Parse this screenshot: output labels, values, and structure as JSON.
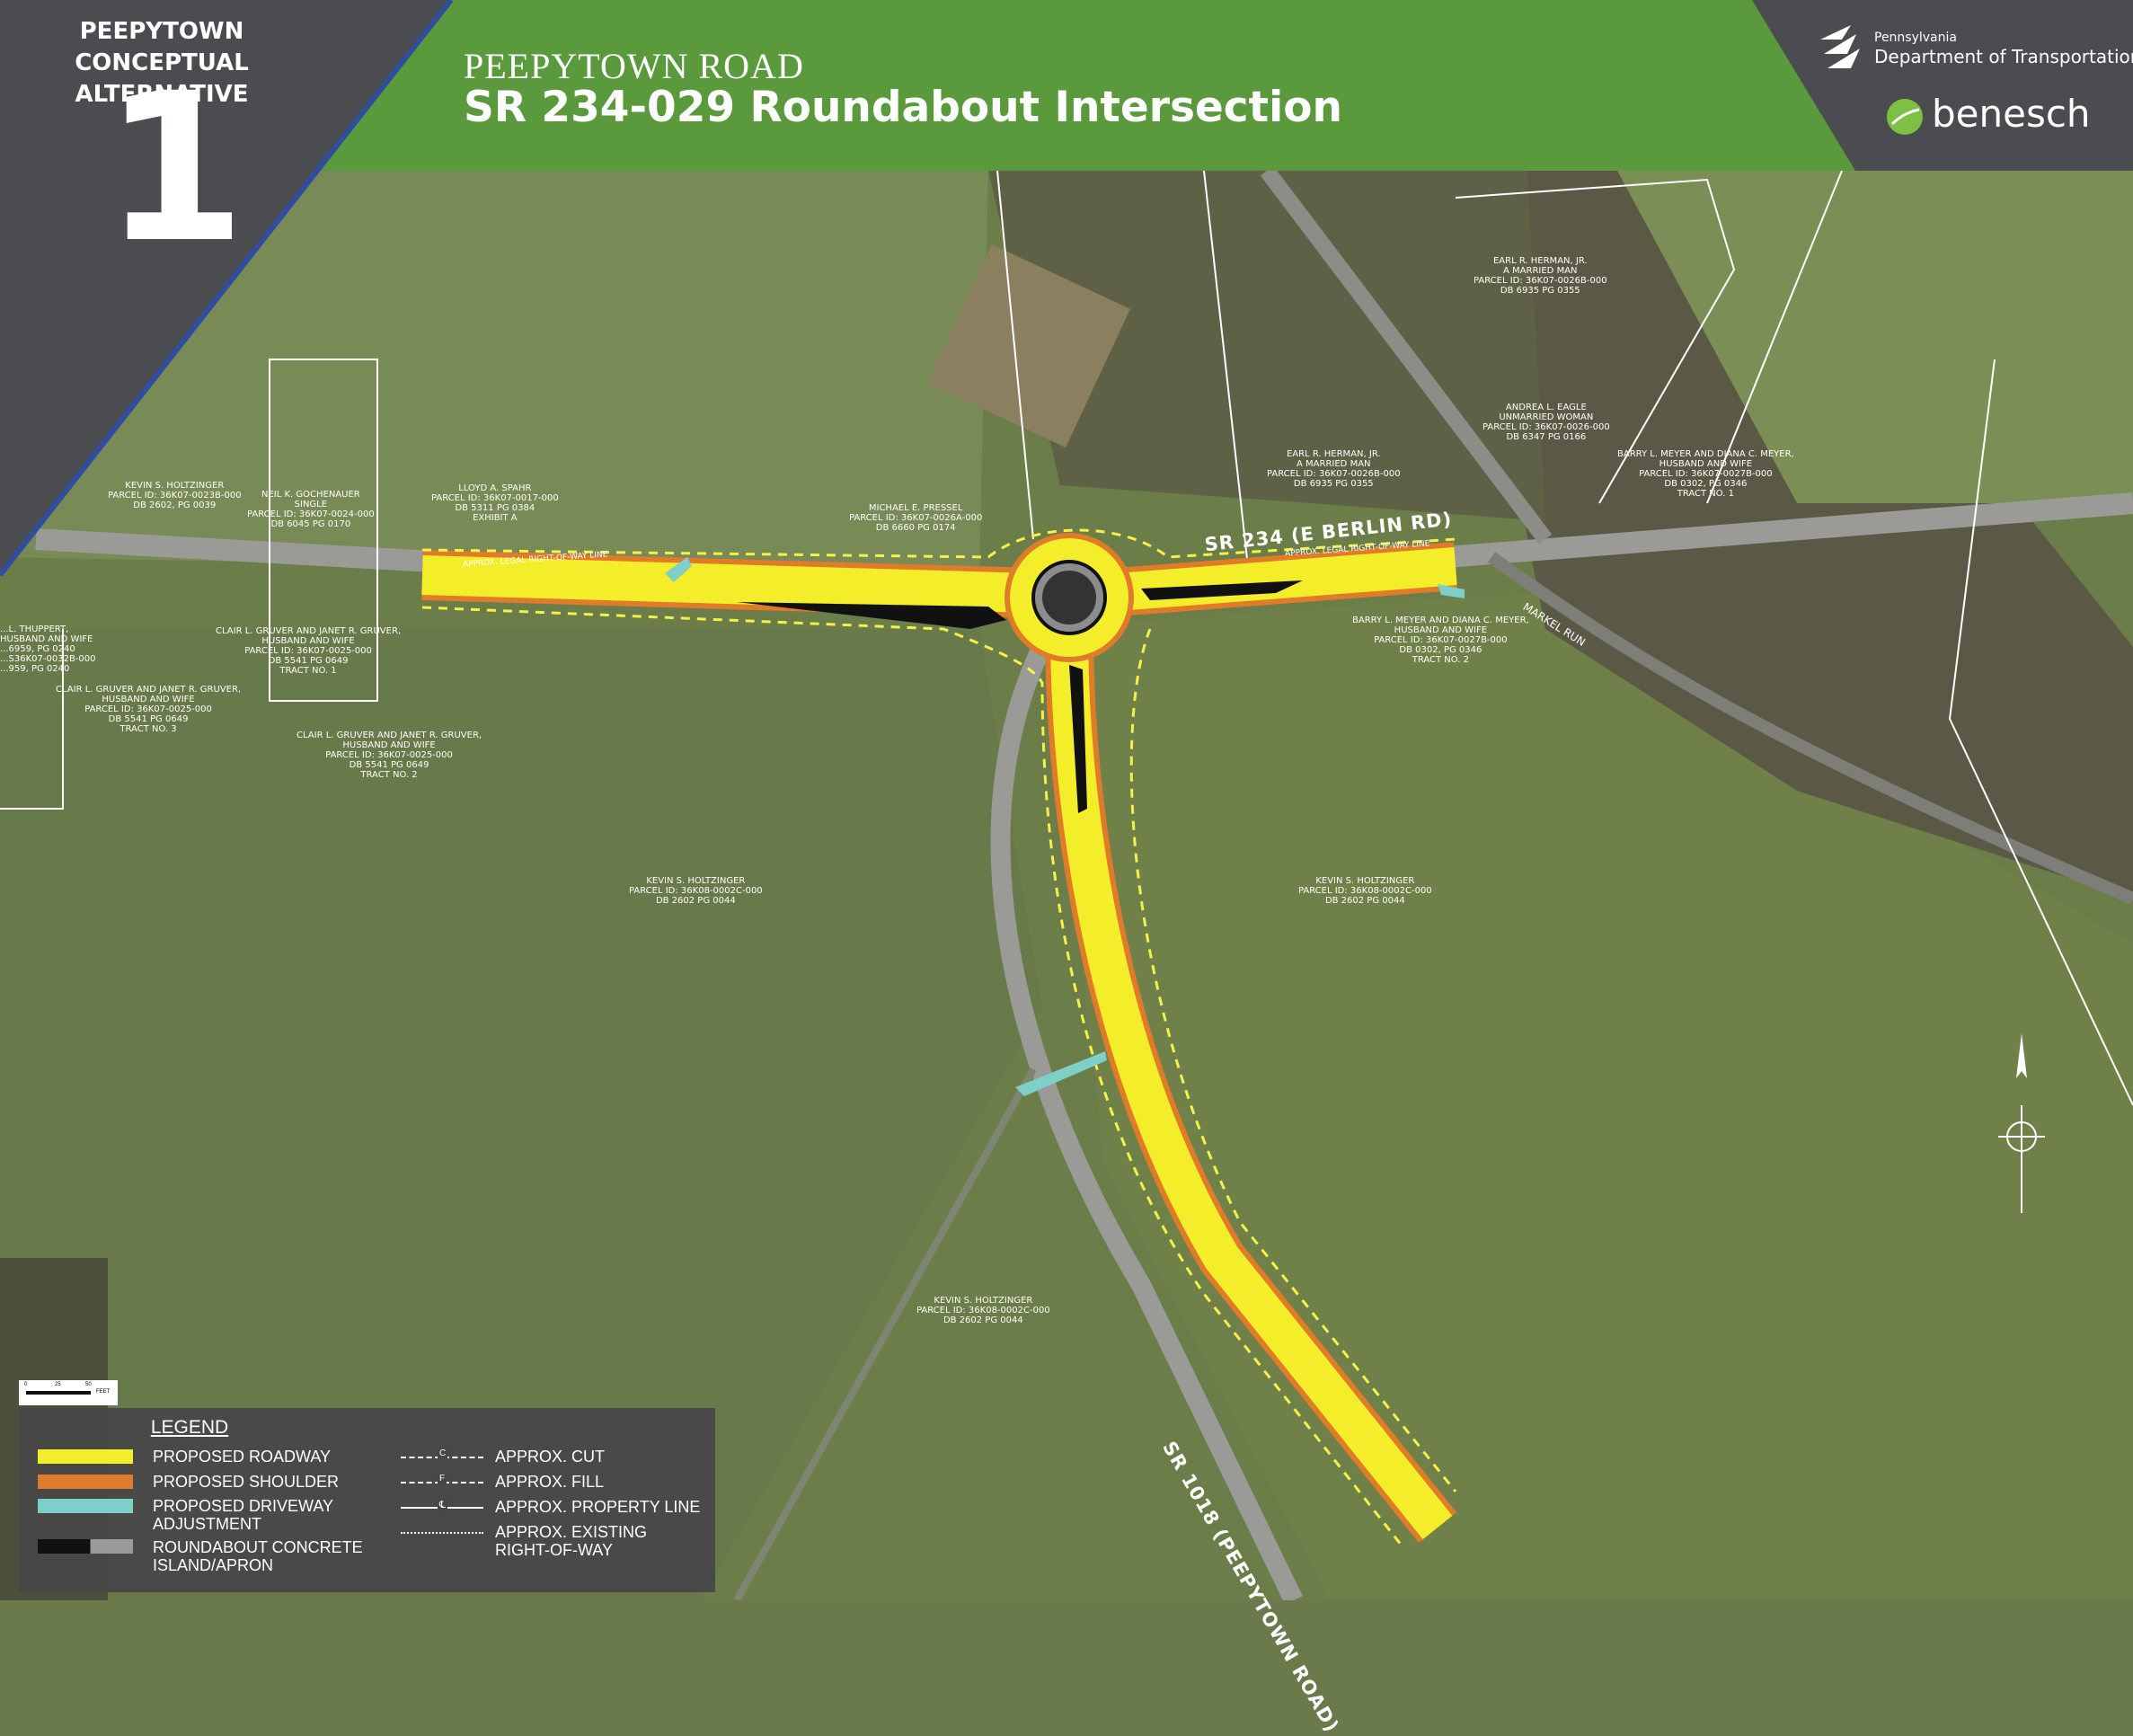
{
  "header": {
    "alt_title_line1": "PEEPYTOWN",
    "alt_title_line2": "CONCEPTUAL ALTERNATIVE",
    "alt_number": "1",
    "project_subtitle": "PEEPYTOWN ROAD",
    "project_title": "SR 234-029 Roundabout Intersection",
    "penndot_small": "Pennsylvania",
    "penndot_big": "Department of Transportation",
    "benesch": "benesch"
  },
  "roads": {
    "sr234": "SR 234 (E BERLIN RD)",
    "sr1018": "SR 1018 (PEEPYTOWN ROAD)",
    "markel": "MARKEL RUN"
  },
  "parcels": [
    {
      "id": "p1",
      "lines": [
        "KEVIN S. HOLTZINGER",
        "PARCEL ID: 36K07-0023B-000",
        "DB 2602, PG 0039"
      ]
    },
    {
      "id": "p2",
      "lines": [
        "NEIL K. GOCHENAUER",
        "SINGLE",
        "PARCEL ID: 36K07-0024-000",
        "DB 6045 PG 0170"
      ]
    },
    {
      "id": "p3",
      "lines": [
        "LLOYD A. SPAHR",
        "PARCEL ID: 36K07-0017-000",
        "DB 5311 PG 0384",
        "EXHIBIT A"
      ]
    },
    {
      "id": "p4",
      "lines": [
        "MICHAEL E. PRESSEL",
        "PARCEL ID: 36K07-0026A-000",
        "DB 6660 PG 0174"
      ]
    },
    {
      "id": "p5",
      "lines": [
        "EARL R. HERMAN, JR.",
        "A MARRIED MAN",
        "PARCEL ID: 36K07-0026B-000",
        "DB 6935 PG 0355"
      ]
    },
    {
      "id": "p6",
      "lines": [
        "EARL R. HERMAN, JR.",
        "A MARRIED MAN",
        "PARCEL ID: 36K07-0026B-000",
        "DB 6935 PG 0355"
      ]
    },
    {
      "id": "p7",
      "lines": [
        "ANDREA L. EAGLE",
        "UNMARRIED WOMAN",
        "PARCEL ID: 36K07-0026-000",
        "DB 6347 PG 0166"
      ]
    },
    {
      "id": "p8",
      "lines": [
        "BARRY L. MEYER AND DIANA C. MEYER,",
        "HUSBAND AND WIFE",
        "PARCEL ID: 36K07-0027B-000",
        "DB 0302, PG 0346",
        "TRACT NO. 1"
      ]
    },
    {
      "id": "p9",
      "lines": [
        "BARRY L. MEYER AND DIANA C. MEYER,",
        "HUSBAND AND WIFE",
        "PARCEL ID: 36K07-0027B-000",
        "DB 0302, PG 0346",
        "TRACT NO. 2"
      ]
    },
    {
      "id": "p10",
      "lines": [
        "CLAIR L. GRUVER AND JANET R. GRUVER,",
        "HUSBAND AND WIFE",
        "PARCEL ID: 36K07-0025-000",
        "DB 5541 PG 0649",
        "TRACT NO. 1"
      ]
    },
    {
      "id": "p11",
      "lines": [
        "CLAIR L. GRUVER AND JANET R. GRUVER,",
        "HUSBAND AND WIFE",
        "PARCEL ID: 36K07-0025-000",
        "DB 5541 PG 0649",
        "TRACT NO. 3"
      ]
    },
    {
      "id": "p12",
      "lines": [
        "CLAIR L. GRUVER AND JANET R. GRUVER,",
        "HUSBAND AND WIFE",
        "PARCEL ID: 36K07-0025-000",
        "DB 5541 PG 0649",
        "TRACT NO. 2"
      ]
    },
    {
      "id": "p13",
      "lines": [
        "KEVIN S. HOLTZINGER",
        "PARCEL ID: 36K08-0002C-000",
        "DB 2602 PG 0044"
      ]
    },
    {
      "id": "p14",
      "lines": [
        "KEVIN S. HOLTZINGER",
        "PARCEL ID: 36K08-0002C-000",
        "DB 2602 PG 0044"
      ]
    },
    {
      "id": "p15",
      "lines": [
        "KEVIN S. HOLTZINGER",
        "PARCEL ID: 36K08-0002C-000",
        "DB 2602 PG 0044"
      ]
    },
    {
      "id": "p16",
      "lines": [
        "...L. THUPPERT,",
        "HUSBAND AND WIFE",
        "...6959, PG 0240",
        "...S36K07-0032B-000",
        "...959, PG 0240"
      ]
    }
  ],
  "row_label": "APPROX. LEGAL RIGHT-OF-WAY LINE",
  "legend": {
    "title": "LEGEND",
    "items": [
      {
        "label": "PROPOSED ROADWAY",
        "color": "#f4ee2a"
      },
      {
        "label": "PROPOSED SHOULDER",
        "color": "#e07b2a"
      },
      {
        "label": "PROPOSED DRIVEWAY ADJUSTMENT",
        "color": "#7ecfc8"
      },
      {
        "label": "ROUNDABOUT CONCRETE ISLAND/APRON",
        "color": "#111111"
      }
    ],
    "lines": [
      {
        "label": "APPROX. CUT",
        "symbol": "C"
      },
      {
        "label": "APPROX. FILL",
        "symbol": "F"
      },
      {
        "label": "APPROX. PROPERTY LINE",
        "symbol": "℄"
      },
      {
        "label": "APPROX. EXISTING RIGHT-OF-WAY",
        "symbol": ""
      }
    ]
  },
  "scale": {
    "label": "FEET",
    "marks": [
      "0",
      "25",
      "50"
    ]
  },
  "colors": {
    "header_green": "#5a9a3c",
    "header_gray": "#4b4c4f",
    "roadway": "#f4ee2a",
    "shoulder": "#e07b2a",
    "driveway": "#7ecfc8"
  }
}
